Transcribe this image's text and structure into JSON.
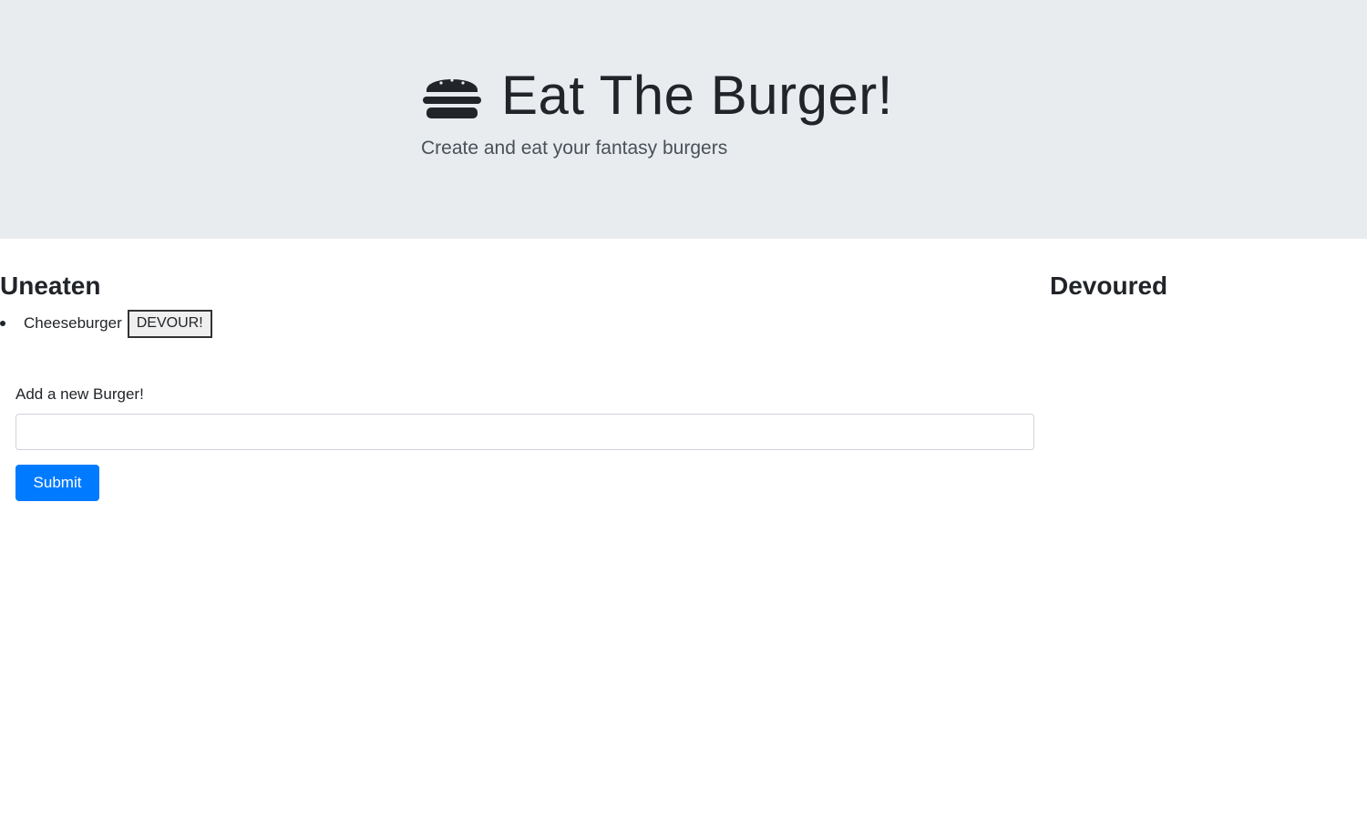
{
  "header": {
    "icon": "hamburger-icon",
    "title": "Eat The Burger!",
    "subtitle": "Create and eat your fantasy burgers",
    "background_color": "#e9ecef"
  },
  "uneaten": {
    "heading": "Uneaten",
    "items": [
      {
        "name": "Cheeseburger",
        "action_label": "DEVOUR!"
      }
    ]
  },
  "devoured": {
    "heading": "Devoured",
    "items": []
  },
  "form": {
    "label": "Add a new Burger!",
    "input_value": "",
    "input_placeholder": "",
    "submit_label": "Submit",
    "submit_color": "#007bff"
  }
}
